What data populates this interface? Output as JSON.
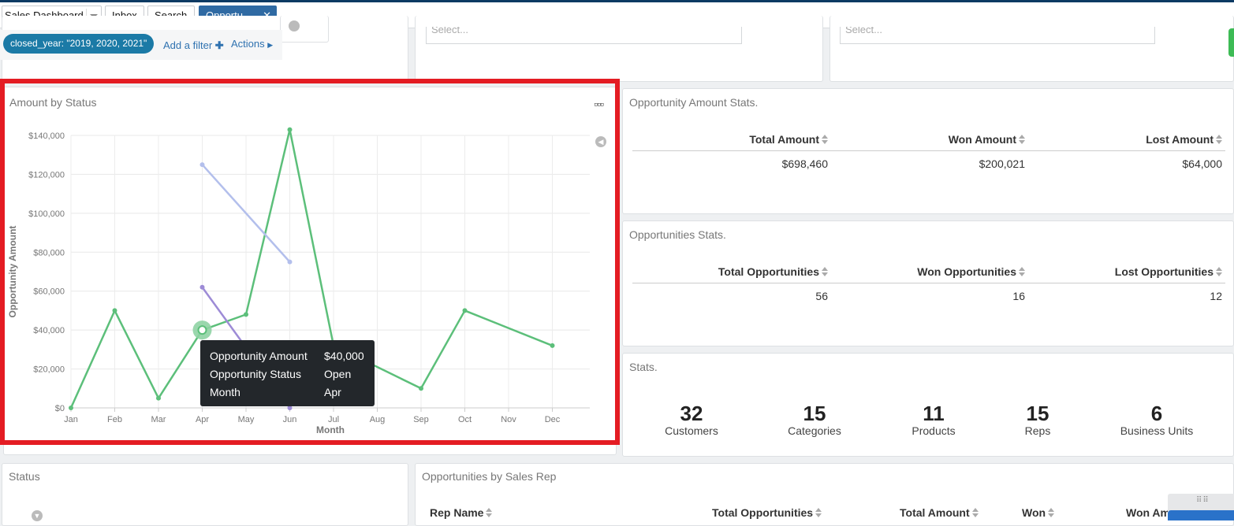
{
  "tabs": {
    "dashboard_select": "Sales Dashboard",
    "inbox": "Inbox",
    "search": "Search",
    "active": "Opportu...",
    "close_glyph": "✕"
  },
  "filters": {
    "pill": "closed_year: \"2019, 2020, 2021\"",
    "add_filter": "Add a filter",
    "actions": "Actions"
  },
  "selects": {
    "placeholder": "Select..."
  },
  "chart_panel": {
    "title": "Amount by Status",
    "more_icon": "more-horizontal-icon"
  },
  "chart_data": {
    "type": "line",
    "title": "Amount by Status",
    "xlabel": "Month",
    "ylabel": "Opportunity Amount",
    "categories": [
      "Jan",
      "Feb",
      "Mar",
      "Apr",
      "May",
      "Jun",
      "Jul",
      "Aug",
      "Sep",
      "Oct",
      "Nov",
      "Dec"
    ],
    "y_ticks": [
      "$0",
      "$20,000",
      "$40,000",
      "$60,000",
      "$80,000",
      "$100,000",
      "$120,000",
      "$140,000"
    ],
    "ylim": [
      0,
      140000
    ],
    "grid": true,
    "series": [
      {
        "color": "#5cbf7a",
        "points": [
          [
            "Jan",
            0
          ],
          [
            "Feb",
            50000
          ],
          [
            "Mar",
            5000
          ],
          [
            "Apr",
            40000
          ],
          [
            "May",
            48000
          ],
          [
            "Jun",
            143000
          ],
          [
            "Jul",
            32000
          ],
          [
            "Sep",
            10000
          ],
          [
            "Oct",
            50000
          ],
          [
            "Dec",
            32000
          ]
        ]
      },
      {
        "color": "#b3bfec",
        "points": [
          [
            "Apr",
            125000
          ],
          [
            "Jun",
            75000
          ]
        ]
      },
      {
        "color": "#9d8bd6",
        "points": [
          [
            "Apr",
            62000
          ],
          [
            "Jun",
            0
          ]
        ]
      }
    ],
    "highlight_point": [
      "Apr",
      40000
    ],
    "tooltip": [
      {
        "key": "Opportunity Amount",
        "value": "$40,000"
      },
      {
        "key": "Opportunity Status",
        "value": "Open"
      },
      {
        "key": "Month",
        "value": "Apr"
      }
    ]
  },
  "amount_stats": {
    "title": "Opportunity Amount Stats.",
    "headers": [
      "Total Amount",
      "Won Amount",
      "Lost Amount"
    ],
    "values": [
      "$698,460",
      "$200,021",
      "$64,000"
    ]
  },
  "opp_stats": {
    "title": "Opportunities Stats.",
    "headers": [
      "Total Opportunities",
      "Won Opportunities",
      "Lost Opportunities"
    ],
    "values": [
      "56",
      "16",
      "12"
    ]
  },
  "stats": {
    "title": "Stats.",
    "items": [
      {
        "value": "32",
        "label": "Customers"
      },
      {
        "value": "15",
        "label": "Categories"
      },
      {
        "value": "11",
        "label": "Products"
      },
      {
        "value": "15",
        "label": "Reps"
      },
      {
        "value": "6",
        "label": "Business Units"
      }
    ]
  },
  "status_panel": {
    "title": "Status"
  },
  "rep_panel": {
    "title": "Opportunities by Sales Rep",
    "columns": [
      "Rep Name",
      "Total Opportunities",
      "Total Amount",
      "Won",
      "Won Am"
    ]
  },
  "colors": {
    "accent": "#2f6aa3",
    "highlight_border": "#e41c23",
    "series_open": "#5cbf7a"
  }
}
